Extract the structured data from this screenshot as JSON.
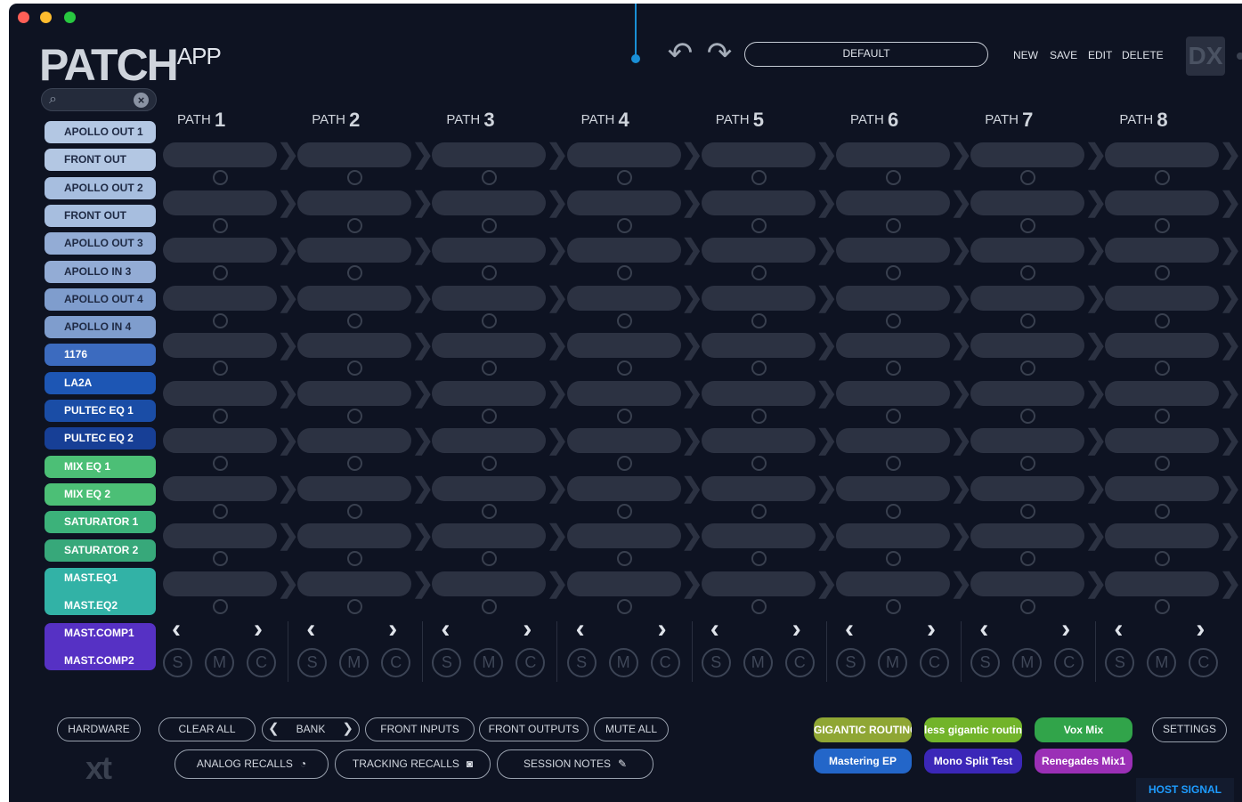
{
  "window": {
    "traffic_lights": [
      "close",
      "minimize",
      "zoom"
    ]
  },
  "header": {
    "logo_main": "PATCH",
    "logo_sub": "APP",
    "undo_icon": "undo-icon",
    "redo_icon": "redo-icon",
    "preset_name": "DEFAULT",
    "buttons": {
      "new": "NEW",
      "save": "SAVE",
      "edit": "EDIT",
      "delete": "DELETE"
    },
    "dx_badge": "DX"
  },
  "search": {
    "icon": "⌕",
    "clear": "×"
  },
  "sources": [
    {
      "label": "APOLLO OUT 1",
      "bg": "#b3c7e3",
      "fg": "#1f2a44"
    },
    {
      "label": "FRONT OUT",
      "bg": "#b3c7e3",
      "fg": "#1f2a44"
    },
    {
      "label": "APOLLO OUT 2",
      "bg": "#a7bedf",
      "fg": "#1f2a44"
    },
    {
      "label": "FRONT OUT",
      "bg": "#a7bedf",
      "fg": "#1f2a44"
    },
    {
      "label": "APOLLO OUT 3",
      "bg": "#93acd5",
      "fg": "#1f2a44"
    },
    {
      "label": "APOLLO IN 3",
      "bg": "#93acd5",
      "fg": "#1f2a44"
    },
    {
      "label": "APOLLO OUT 4",
      "bg": "#7f9dcd",
      "fg": "#1f2a44"
    },
    {
      "label": "APOLLO IN 4",
      "bg": "#7f9dcd",
      "fg": "#1f2a44"
    },
    {
      "label": "1176",
      "bg": "#3c6bbf",
      "fg": "#ffffff"
    },
    {
      "label": "LA2A",
      "bg": "#1d56b4",
      "fg": "#ffffff"
    },
    {
      "label": "PULTEC EQ 1",
      "bg": "#1a4da6",
      "fg": "#ffffff"
    },
    {
      "label": "PULTEC EQ 2",
      "bg": "#173f96",
      "fg": "#ffffff"
    },
    {
      "label": "MIX EQ 1",
      "bg": "#4cbf76",
      "fg": "#ffffff"
    },
    {
      "label": "MIX EQ 2",
      "bg": "#4cbf76",
      "fg": "#ffffff"
    },
    {
      "label": "SATURATOR 1",
      "bg": "#3cb27a",
      "fg": "#ffffff"
    },
    {
      "label": "SATURATOR 2",
      "bg": "#37a87a",
      "fg": "#ffffff"
    }
  ],
  "source_groups": [
    {
      "lines": [
        "MAST.EQ1",
        "MAST.EQ2"
      ],
      "bg": "#32b2a6",
      "fg": "#ffffff"
    },
    {
      "lines": [
        "MAST.COMP1",
        "MAST.COMP2"
      ],
      "bg": "#5631c4",
      "fg": "#ffffff"
    }
  ],
  "paths": [
    {
      "label": "PATH",
      "num": "1"
    },
    {
      "label": "PATH",
      "num": "2"
    },
    {
      "label": "PATH",
      "num": "3"
    },
    {
      "label": "PATH",
      "num": "4"
    },
    {
      "label": "PATH",
      "num": "5"
    },
    {
      "label": "PATH",
      "num": "6"
    },
    {
      "label": "PATH",
      "num": "7"
    },
    {
      "label": "PATH",
      "num": "8"
    }
  ],
  "path_controls": {
    "prev": "‹",
    "next": "›",
    "solo": "S",
    "mute": "M",
    "clear": "C"
  },
  "footer": {
    "hardware": "HARDWARE",
    "clear_all": "CLEAR ALL",
    "bank": "BANK",
    "bank_prev": "❮",
    "bank_next": "❯",
    "front_inputs": "FRONT INPUTS",
    "front_outputs": "FRONT OUTPUTS",
    "mute_all": "MUTE ALL",
    "analog_recalls": "ANALOG RECALLS",
    "analog_icon": "gauge-icon",
    "tracking_recalls": "TRACKING RECALLS",
    "tracking_icon": "camera-icon",
    "session_notes": "SESSION NOTES",
    "session_icon": "pencil-icon",
    "xt_logo": "xt"
  },
  "sessions": [
    {
      "label": "GIGANTIC ROUTING",
      "bg": "#8fa634",
      "fg": "#ffffff"
    },
    {
      "label": "less gigantic routing",
      "bg": "#72b42a",
      "fg": "#ffffff"
    },
    {
      "label": "Vox Mix",
      "bg": "#31a44a",
      "fg": "#ffffff"
    },
    {
      "label": "Mastering EP",
      "bg": "#2366c9",
      "fg": "#ffffff"
    },
    {
      "label": "Mono Split Test",
      "bg": "#3b27b8",
      "fg": "#ffffff"
    },
    {
      "label": "Renegades Mix1",
      "bg": "#9b2fb6",
      "fg": "#ffffff"
    }
  ],
  "settings": "SETTINGS",
  "status": {
    "host_signal": "HOST SIGNAL"
  }
}
